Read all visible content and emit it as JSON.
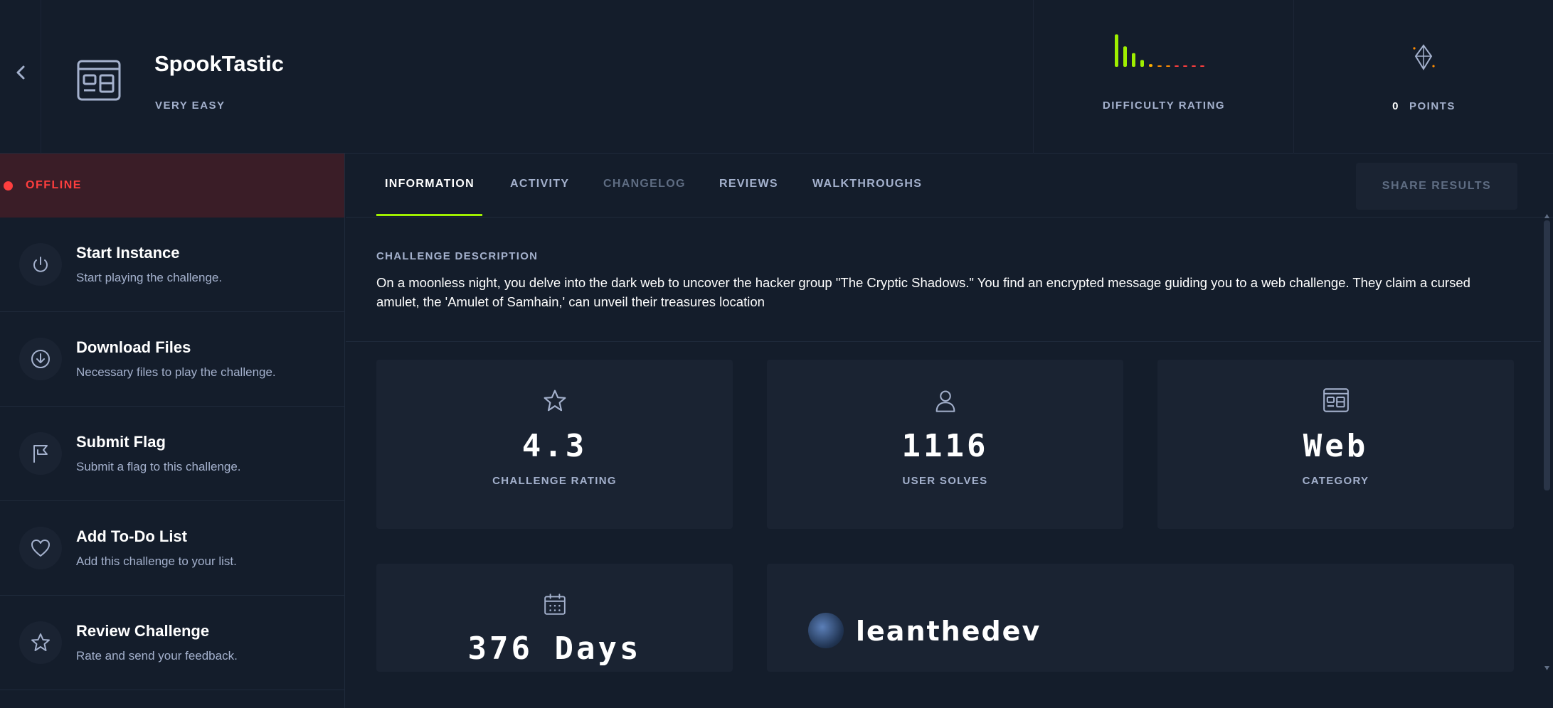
{
  "header": {
    "title": "SpookTastic",
    "difficulty": "VERY EASY",
    "difficulty_rating_label": "DIFFICULTY RATING",
    "difficulty_bars": [
      0.95,
      0.6,
      0.4,
      0.2,
      0.08,
      0.04,
      0.04,
      0.04,
      0.04,
      0.04,
      0.04
    ],
    "points_value": "0",
    "points_label": "POINTS"
  },
  "status": {
    "label": "OFFLINE",
    "color": "#ff3e3e"
  },
  "sidebar": {
    "items": [
      {
        "title": "Start Instance",
        "subtitle": "Start playing the challenge.",
        "icon": "power-icon"
      },
      {
        "title": "Download Files",
        "subtitle": "Necessary files to play the challenge.",
        "icon": "download-icon"
      },
      {
        "title": "Submit Flag",
        "subtitle": "Submit a flag to this challenge.",
        "icon": "flag-icon"
      },
      {
        "title": "Add To-Do List",
        "subtitle": "Add this challenge to your list.",
        "icon": "heart-icon"
      },
      {
        "title": "Review Challenge",
        "subtitle": "Rate and send your feedback.",
        "icon": "star-icon"
      }
    ]
  },
  "tabs": [
    {
      "label": "INFORMATION",
      "active": true
    },
    {
      "label": "ACTIVITY",
      "active": false
    },
    {
      "label": "CHANGELOG",
      "active": false
    },
    {
      "label": "REVIEWS",
      "active": false
    },
    {
      "label": "WALKTHROUGHS",
      "active": false
    }
  ],
  "share_button": "SHARE RESULTS",
  "description": {
    "label": "CHALLENGE DESCRIPTION",
    "text": "On a moonless night, you delve into the dark web to uncover the hacker group \"The Cryptic Shadows.\" You find an encrypted message guiding you to a web challenge. They claim a cursed amulet, the 'Amulet of Samhain,' can unveil their treasures location"
  },
  "stats": [
    {
      "value": "4.3",
      "label": "CHALLENGE RATING",
      "icon": "star-icon"
    },
    {
      "value": "1116",
      "label": "USER SOLVES",
      "icon": "user-icon"
    },
    {
      "value": "Web",
      "label": "CATEGORY",
      "icon": "browser-icon"
    },
    {
      "value": "376 Days",
      "label": "",
      "icon": "calendar-icon"
    }
  ],
  "author": {
    "name": "leanthedev"
  },
  "colors": {
    "accent": "#9fef00",
    "background": "#141d2b",
    "card": "#1a2332",
    "muted_text": "#a4b1cd",
    "offline": "#ff3e3e"
  }
}
